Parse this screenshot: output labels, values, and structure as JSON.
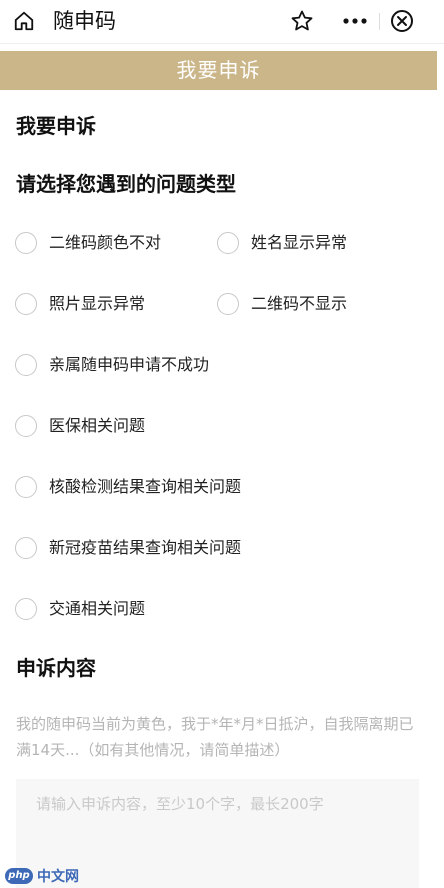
{
  "topbar": {
    "title": "随申码",
    "icons": [
      "home-icon",
      "star-icon",
      "more-icon",
      "close-circle-icon"
    ]
  },
  "banner": {
    "title": "我要申诉"
  },
  "page": {
    "heading": "我要申诉",
    "question_type_heading": "请选择您遇到的问题类型",
    "content_heading": "申诉内容",
    "hint": "我的随申码当前为黄色，我于*年*月*日抵沪，自我隔离期已满14天...（如有其他情况，请简单描述）",
    "textarea_placeholder": "请输入申诉内容，至少10个字，最长200字"
  },
  "options": [
    {
      "label": "二维码颜色不对",
      "selected": false
    },
    {
      "label": "姓名显示异常",
      "selected": false
    },
    {
      "label": "照片显示异常",
      "selected": false
    },
    {
      "label": "二维码不显示",
      "selected": false
    },
    {
      "label": "亲属随申码申请不成功",
      "selected": false
    },
    {
      "label": "医保相关问题",
      "selected": false
    },
    {
      "label": "核酸检测结果查询相关问题",
      "selected": false
    },
    {
      "label": "新冠疫苗结果查询相关问题",
      "selected": false
    },
    {
      "label": "交通相关问题",
      "selected": false
    }
  ],
  "watermark": {
    "badge": "php",
    "text": "中文网"
  },
  "colors": {
    "banner": "#cbb68a",
    "radio_border": "#c8c8c8",
    "hint": "#b5b5b5"
  }
}
